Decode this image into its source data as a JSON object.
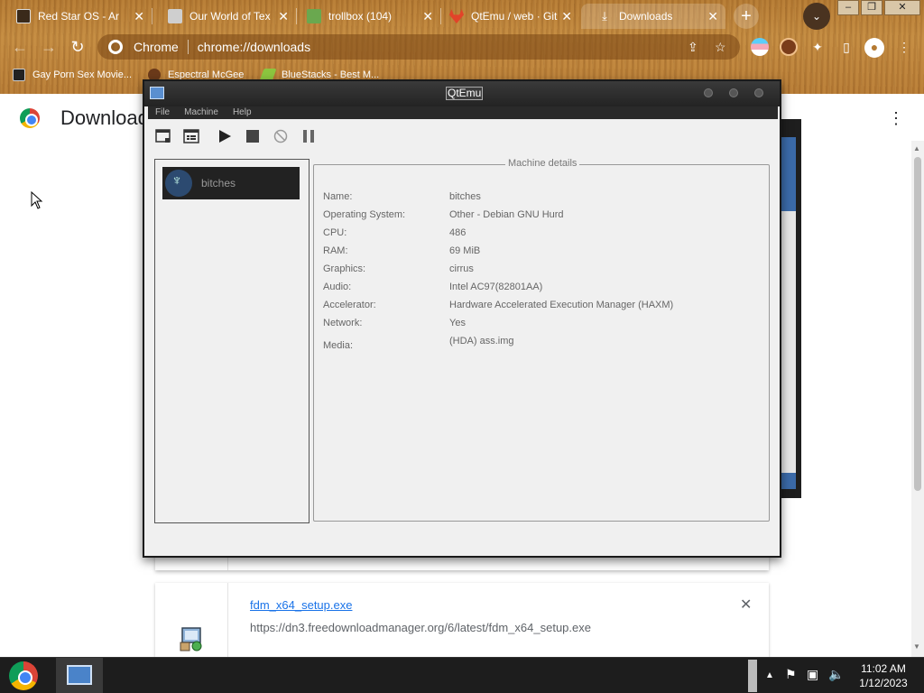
{
  "browser": {
    "tabs": [
      {
        "title": "Red Star OS - Ar",
        "icon_color": "#3a2a1a"
      },
      {
        "title": "Our World of Tex",
        "icon_color": "#cfcfcf"
      },
      {
        "title": "trollbox (104)",
        "icon_color": "#6aa84f"
      },
      {
        "title": "QtEmu / web · GitL",
        "icon_color": "#e24329"
      },
      {
        "title": "Downloads",
        "icon_color": "#ffffff"
      }
    ],
    "omnibox": {
      "site_chip": "Chrome",
      "url": "chrome://downloads"
    },
    "bookmarks": [
      {
        "label": "Gay Porn Sex Movie..."
      },
      {
        "label": "Espectral McGee"
      },
      {
        "label": "BlueStacks - Best M..."
      }
    ]
  },
  "downloads_page": {
    "title": "Downloads",
    "item": {
      "filename": "fdm_x64_setup.exe",
      "url": "https://dn3.freedownloadmanager.org/6/latest/fdm_x64_setup.exe"
    }
  },
  "qtemu": {
    "window_title": "QtEmu",
    "menu": [
      "File",
      "Machine",
      "Help"
    ],
    "vm_list": [
      {
        "name": "bitches"
      }
    ],
    "details_title": "Machine details",
    "details": [
      {
        "label": "Name:",
        "value": "bitches"
      },
      {
        "label": "Operating System:",
        "value": "Other - Debian GNU Hurd"
      },
      {
        "label": "CPU:",
        "value": "486"
      },
      {
        "label": "RAM:",
        "value": "69 MiB"
      },
      {
        "label": "Graphics:",
        "value": "cirrus"
      },
      {
        "label": "Audio:",
        "value": "Intel AC97(82801AA)"
      },
      {
        "label": "Accelerator:",
        "value": "Hardware Accelerated Execution Manager (HAXM)"
      },
      {
        "label": "Network:",
        "value": "Yes"
      },
      {
        "label": "Media:",
        "value": "(HDA) ass.img"
      }
    ]
  },
  "taskbar": {
    "time": "11:02 AM",
    "date": "1/12/2023"
  }
}
